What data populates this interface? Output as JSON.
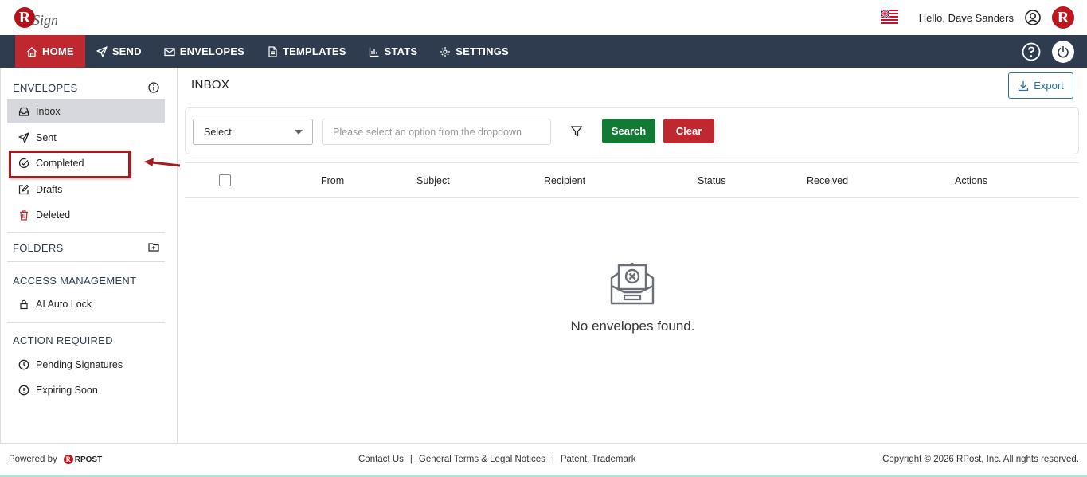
{
  "header": {
    "logo_letter": "R",
    "logo_text": "Sign",
    "greeting": "Hello, Dave Sanders",
    "avatar_letter": "R"
  },
  "nav": {
    "items": [
      {
        "label": "HOME",
        "icon": "home-icon",
        "active": true
      },
      {
        "label": "SEND",
        "icon": "send-icon"
      },
      {
        "label": "ENVELOPES",
        "icon": "envelope-icon"
      },
      {
        "label": "TEMPLATES",
        "icon": "document-icon"
      },
      {
        "label": "STATS",
        "icon": "bar-chart-icon"
      },
      {
        "label": "SETTINGS",
        "icon": "gear-icon"
      }
    ]
  },
  "sidebar": {
    "envelopes_title": "ENVELOPES",
    "items": [
      {
        "label": "Inbox",
        "icon": "inbox-icon"
      },
      {
        "label": "Sent",
        "icon": "send-icon"
      },
      {
        "label": "Completed",
        "icon": "check-circle-icon"
      },
      {
        "label": "Drafts",
        "icon": "edit-icon"
      },
      {
        "label": "Deleted",
        "icon": "trash-icon"
      }
    ],
    "folders_title": "FOLDERS",
    "access_title": "ACCESS MANAGEMENT",
    "access_items": [
      {
        "label": "AI Auto Lock",
        "icon": "lock-icon"
      }
    ],
    "action_title": "ACTION REQUIRED",
    "action_items": [
      {
        "label": "Pending Signatures",
        "icon": "clock-icon"
      },
      {
        "label": "Expiring Soon",
        "icon": "alert-circle-icon"
      }
    ]
  },
  "main": {
    "title": "INBOX",
    "export_label": "Export",
    "select_value": "Select",
    "search_placeholder": "Please select an option from the dropdown",
    "search_label": "Search",
    "clear_label": "Clear",
    "columns": [
      "From",
      "Subject",
      "Recipient",
      "Status",
      "Received",
      "Actions"
    ],
    "empty_text": "No envelopes found."
  },
  "footer": {
    "powered_by": "Powered by",
    "rpost_text": "RPOST",
    "links": [
      "Contact Us",
      "General Terms & Legal Notices",
      "Patent, Trademark"
    ],
    "separator": "|",
    "copyright": "Copyright © 2026 RPost, Inc. All rights reserved."
  },
  "colors": {
    "nav_bg": "#2f3c4f",
    "active_red": "#c0282f",
    "search_green": "#137a35",
    "export_blue": "#2b6fb3"
  }
}
